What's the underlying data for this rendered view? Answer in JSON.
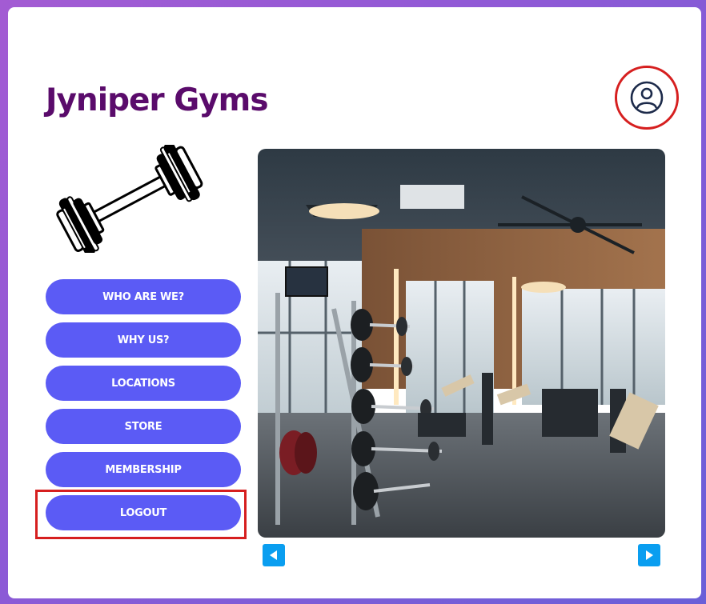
{
  "header": {
    "title": "Jyniper Gyms",
    "profile_icon": "user-circle-icon"
  },
  "logo": {
    "icon": "dumbbell-icon"
  },
  "nav": {
    "items": [
      {
        "label": "WHO ARE WE?"
      },
      {
        "label": "WHY US?"
      },
      {
        "label": "LOCATIONS"
      },
      {
        "label": "STORE"
      },
      {
        "label": "MEMBERSHIP"
      },
      {
        "label": "LOGOUT"
      }
    ]
  },
  "carousel": {
    "image": "gym-interior-photo",
    "prev_icon": "triangle-left-icon",
    "next_icon": "triangle-right-icon"
  },
  "colors": {
    "title": "#5a0b6b",
    "button": "#5b5bf5",
    "highlight": "#d61f1f",
    "arrow": "#0a9ef0"
  }
}
